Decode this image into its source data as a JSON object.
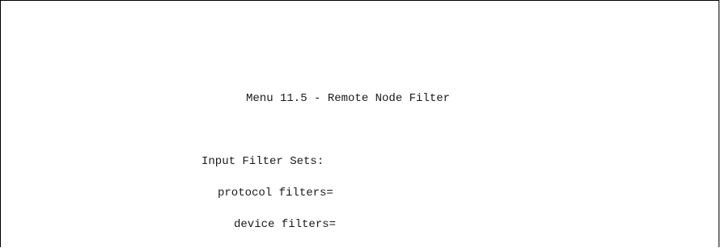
{
  "screen": {
    "title": "Menu 11.5 - Remote Node Filter",
    "input_filter_sets": {
      "heading": "Input Filter Sets:",
      "protocol_filters_label": "protocol filters=",
      "device_filters_label": "device filters="
    }
  }
}
